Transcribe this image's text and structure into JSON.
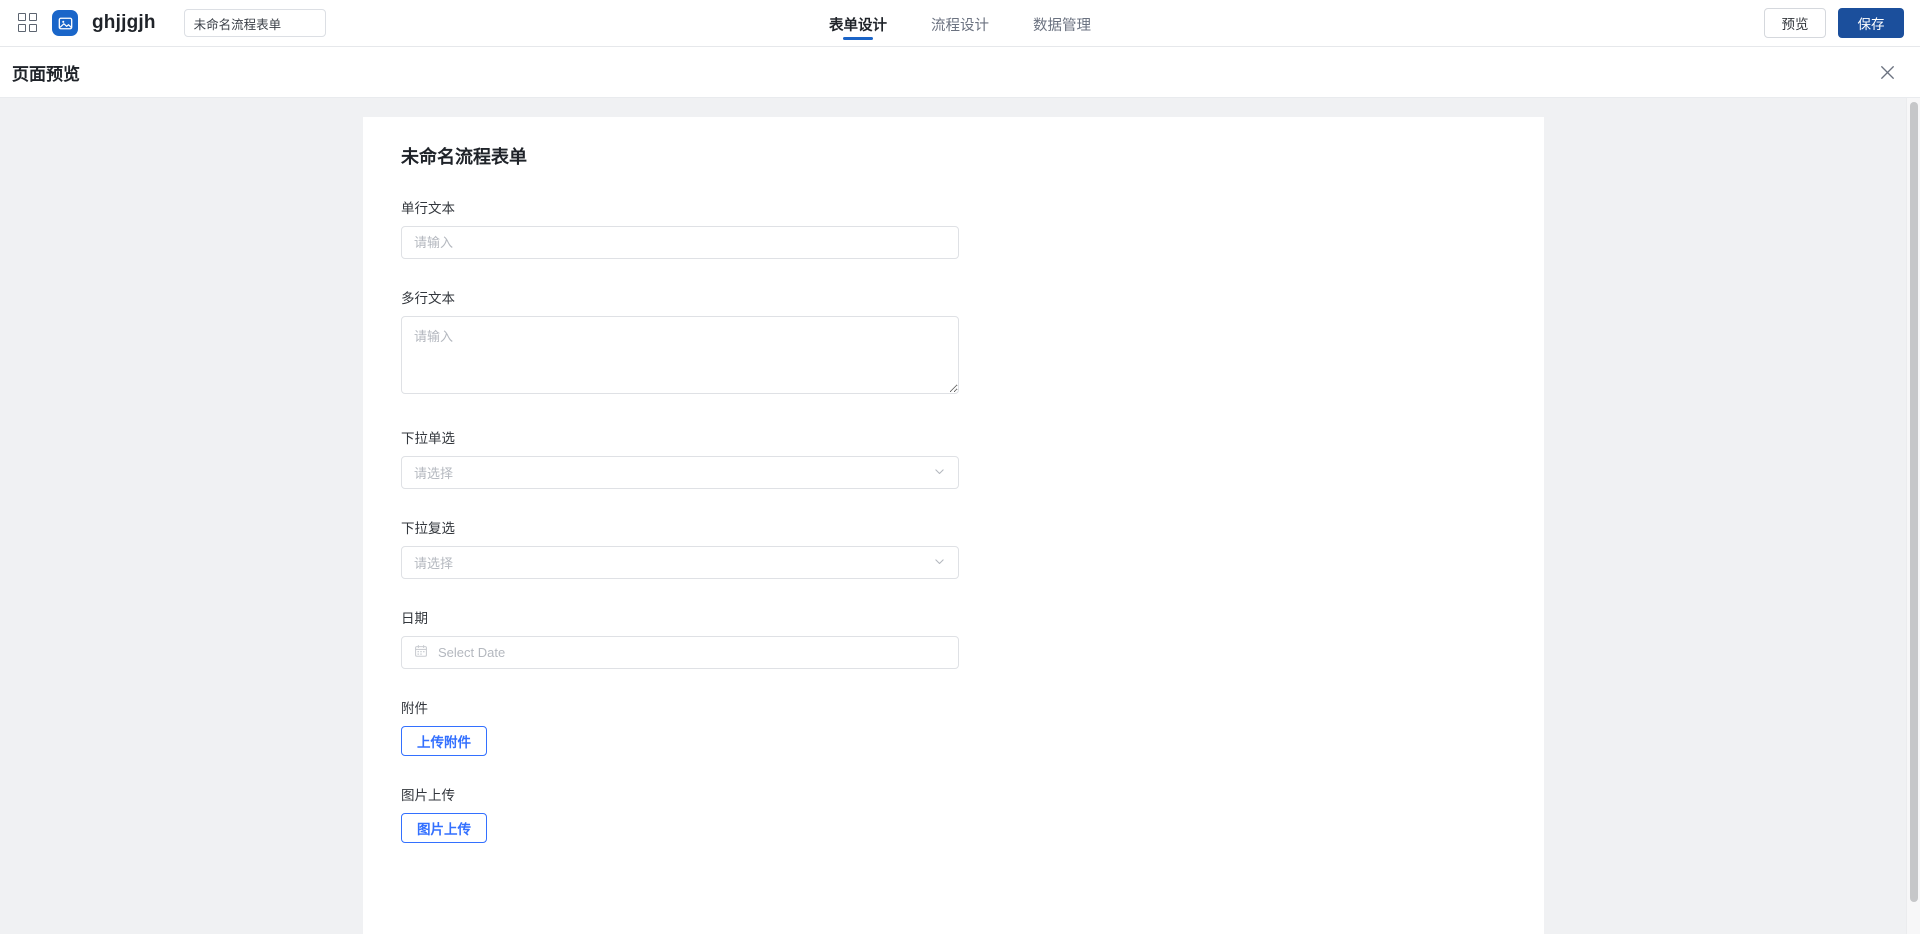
{
  "appbar": {
    "grid_icon": "grid-apps-icon",
    "logo_icon": "image-app-icon",
    "app_name": "ghjjgjh",
    "form_name_value": "未命名流程表单",
    "form_name_placeholder": "未命名流程表单",
    "tabs": [
      {
        "label": "表单设计",
        "active": true
      },
      {
        "label": "流程设计",
        "active": false
      },
      {
        "label": "数据管理",
        "active": false
      }
    ],
    "preview_label": "预览",
    "save_label": "保存",
    "accent_color": "#1b64c7",
    "primary_button_color": "#1b4f9c"
  },
  "preview": {
    "title": "页面预览",
    "close_icon": "close-icon"
  },
  "form": {
    "title": "未命名流程表单",
    "fields": [
      {
        "label": "单行文本",
        "type": "text",
        "value": "",
        "placeholder": "请输入"
      },
      {
        "label": "多行文本",
        "type": "textarea",
        "value": "",
        "placeholder": "请输入"
      },
      {
        "label": "下拉单选",
        "type": "select",
        "value": "",
        "placeholder": "请选择",
        "icon": "chevron-down-icon"
      },
      {
        "label": "下拉复选",
        "type": "multiselect",
        "value": "",
        "placeholder": "请选择",
        "icon": "chevron-down-icon"
      },
      {
        "label": "日期",
        "type": "date",
        "value": "",
        "placeholder": "Select Date",
        "icon": "calendar-icon"
      },
      {
        "label": "附件",
        "type": "file-upload",
        "button_label": "上传附件"
      },
      {
        "label": "图片上传",
        "type": "image-upload",
        "button_label": "图片上传"
      }
    ],
    "upload_accent_color": "#3370ff"
  }
}
